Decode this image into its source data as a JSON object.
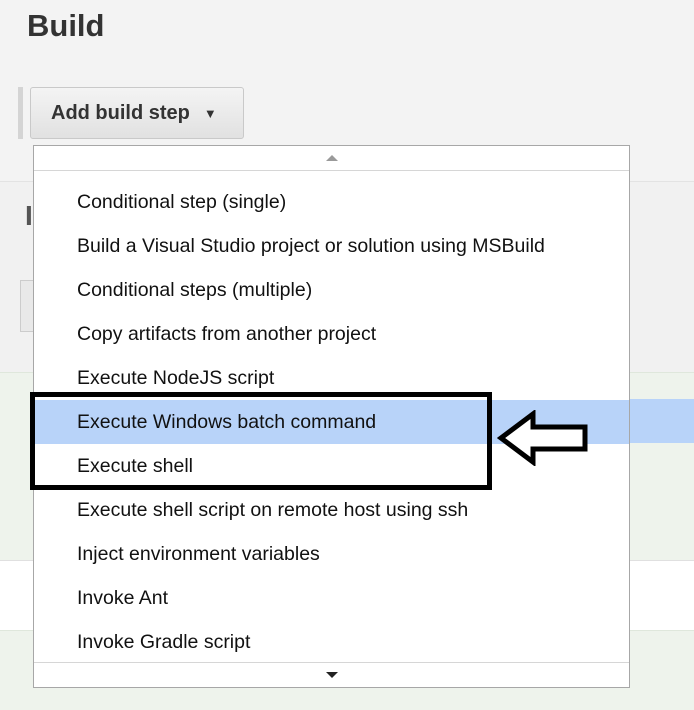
{
  "section": {
    "title": "Build"
  },
  "add_button": {
    "label": "Add build step",
    "caret": "▼"
  },
  "dropdown": {
    "items": [
      "Conditional step (single)",
      "Build a Visual Studio project or solution using MSBuild",
      "Conditional steps (multiple)",
      "Copy artifacts from another project",
      "Execute NodeJS script",
      "Execute Windows batch command",
      "Execute shell",
      "Execute shell script on remote host using ssh",
      "Inject environment variables",
      "Invoke Ant",
      "Invoke Gradle script"
    ],
    "highlighted_item": "Execute Windows batch command",
    "highlight_color": "#b8d3f9"
  },
  "annotation": {
    "box_color": "#000000",
    "arrow_icon": "left-arrow-icon"
  }
}
